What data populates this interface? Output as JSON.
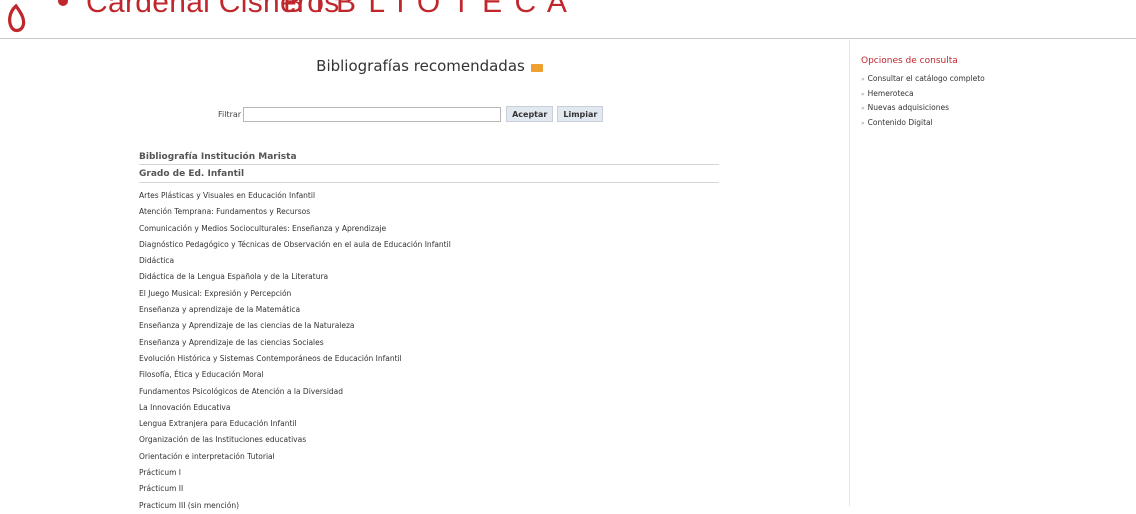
{
  "header": {
    "logo_text": "Cardenal Cisneros",
    "logo_tail": "B I B L I O T E C A",
    "brand_color": "#c0272d"
  },
  "main": {
    "title": "Bibliografías recomendadas",
    "title_icon": "rss-icon",
    "filter": {
      "label": "Filtrar",
      "value": "",
      "accept_label": "Aceptar",
      "clear_label": "Limpiar"
    },
    "institution_heading": "Bibliografía Institución Marista",
    "degree_heading": "Grado de Ed. Infantil",
    "courses": [
      "Artes Plásticas y Visuales en Educación Infantil",
      "Atención Temprana: Fundamentos y Recursos",
      "Comunicación y Medios Socioculturales: Enseñanza y Aprendizaje",
      "Diagnóstico Pedagógico y Técnicas de Observación en el aula de Educación Infantil",
      "Didáctica",
      "Didáctica de la Lengua Española y de la Literatura",
      "El Juego Musical: Expresión y Percepción",
      "Enseñanza y aprendizaje de la Matemática",
      "Enseñanza y Aprendizaje de las ciencias de la Naturaleza",
      "Enseñanza y Aprendizaje de las ciencias Sociales",
      "Evolución Histórica y Sistemas Contemporáneos de Educación Infantil",
      "Filosofía, Ética y Educación Moral",
      "Fundamentos Psicológicos de Atención a la Diversidad",
      "La Innovación Educativa",
      "Lengua Extranjera para Educación Infantil",
      "Organización de las Instituciones educativas",
      "Orientación e interpretación Tutorial",
      "Prácticum I",
      "Prácticum II",
      "Practicum III (sin mención)"
    ]
  },
  "sidebar": {
    "title": "Opciones de consulta",
    "items": [
      "Consultar el catálogo completo",
      "Hemeroteca",
      "Nuevas adquisiciones",
      "Contenido Digital"
    ]
  }
}
